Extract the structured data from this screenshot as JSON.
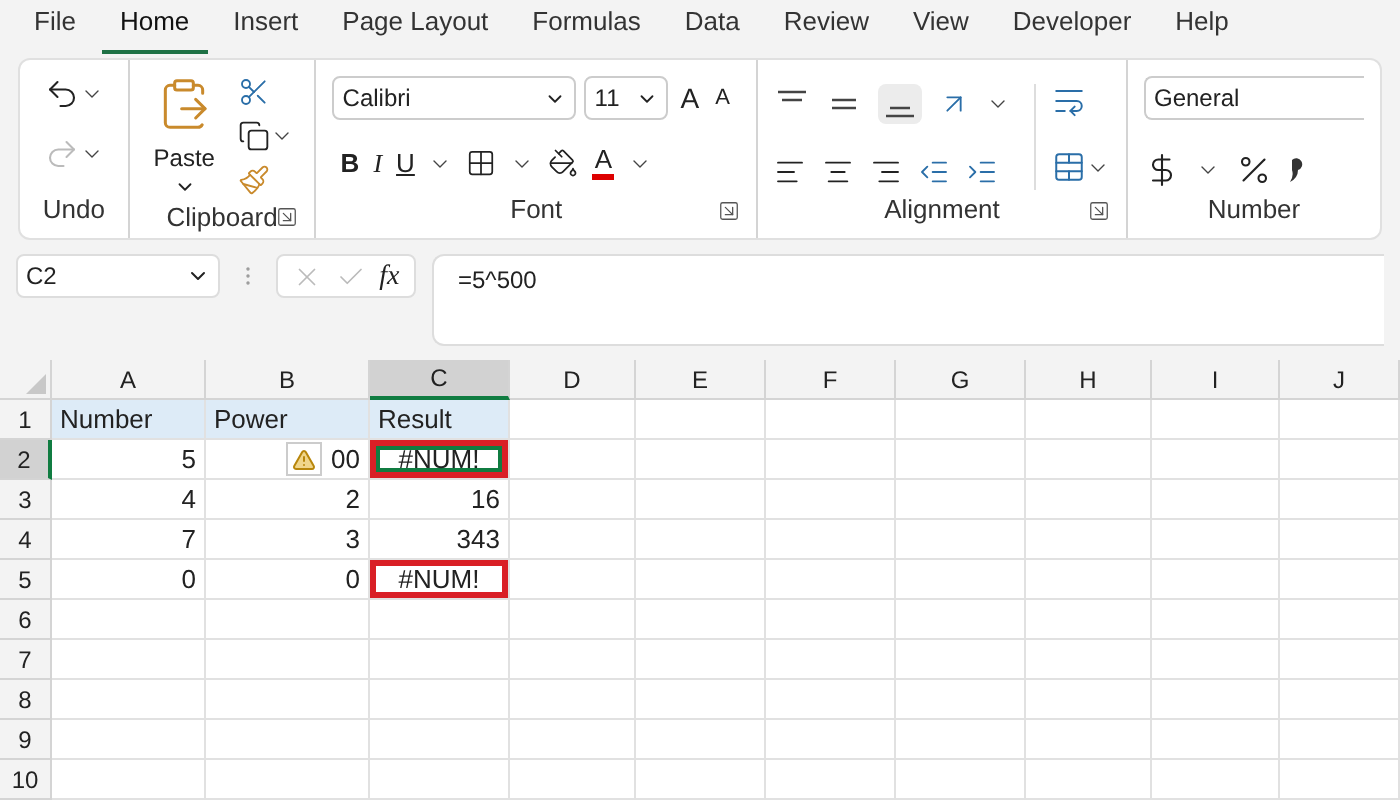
{
  "menu": [
    {
      "label": "File",
      "selected": false
    },
    {
      "label": "Home",
      "selected": true
    },
    {
      "label": "Insert",
      "selected": false
    },
    {
      "label": "Page Layout",
      "selected": false
    },
    {
      "label": "Formulas",
      "selected": false
    },
    {
      "label": "Data",
      "selected": false
    },
    {
      "label": "Review",
      "selected": false
    },
    {
      "label": "View",
      "selected": false
    },
    {
      "label": "Developer",
      "selected": false
    },
    {
      "label": "Help",
      "selected": false
    }
  ],
  "ribbon": {
    "undo": {
      "label": "Undo"
    },
    "clipboard": {
      "label": "Clipboard",
      "paste": "Paste"
    },
    "font": {
      "label": "Font",
      "name": "Calibri",
      "size": "11",
      "bold": "B",
      "italic": "I",
      "underline": "U",
      "grow": "A",
      "shrink": "A",
      "font_color_letter": "A"
    },
    "alignment": {
      "label": "Alignment"
    },
    "number": {
      "label": "Number",
      "format": "General"
    }
  },
  "formula_bar": {
    "name_box": "C2",
    "fx": "fx",
    "formula": "=5^500"
  },
  "sheet": {
    "columns": [
      {
        "label": "A",
        "selected": false
      },
      {
        "label": "B",
        "selected": false
      },
      {
        "label": "C",
        "selected": true
      },
      {
        "label": "D",
        "selected": false
      },
      {
        "label": "E",
        "selected": false
      },
      {
        "label": "F",
        "selected": false
      },
      {
        "label": "G",
        "selected": false
      },
      {
        "label": "H",
        "selected": false
      },
      {
        "label": "I",
        "selected": false
      },
      {
        "label": "J",
        "selected": false
      }
    ],
    "rows": [
      {
        "label": "1",
        "selected": false,
        "cells": [
          {
            "text": "Number",
            "kind": "header",
            "selected": false,
            "highlighted": false,
            "warning": false
          },
          {
            "text": "Power",
            "kind": "header",
            "selected": false,
            "highlighted": false,
            "warning": false
          },
          {
            "text": "Result",
            "kind": "header",
            "selected": false,
            "highlighted": false,
            "warning": false
          }
        ]
      },
      {
        "label": "2",
        "selected": true,
        "cells": [
          {
            "text": "5",
            "kind": "number",
            "selected": false,
            "highlighted": false,
            "warning": false
          },
          {
            "text": "00",
            "kind": "number",
            "selected": false,
            "highlighted": false,
            "warning": true
          },
          {
            "text": "#NUM!",
            "kind": "error",
            "selected": true,
            "highlighted": true,
            "warning": false
          }
        ]
      },
      {
        "label": "3",
        "selected": false,
        "cells": [
          {
            "text": "4",
            "kind": "number",
            "selected": false,
            "highlighted": false,
            "warning": false
          },
          {
            "text": "2",
            "kind": "number",
            "selected": false,
            "highlighted": false,
            "warning": false
          },
          {
            "text": "16",
            "kind": "number",
            "selected": false,
            "highlighted": false,
            "warning": false
          }
        ]
      },
      {
        "label": "4",
        "selected": false,
        "cells": [
          {
            "text": "7",
            "kind": "number",
            "selected": false,
            "highlighted": false,
            "warning": false
          },
          {
            "text": "3",
            "kind": "number",
            "selected": false,
            "highlighted": false,
            "warning": false
          },
          {
            "text": "343",
            "kind": "number",
            "selected": false,
            "highlighted": false,
            "warning": false
          }
        ]
      },
      {
        "label": "5",
        "selected": false,
        "cells": [
          {
            "text": "0",
            "kind": "number",
            "selected": false,
            "highlighted": false,
            "warning": false
          },
          {
            "text": "0",
            "kind": "number",
            "selected": false,
            "highlighted": false,
            "warning": false
          },
          {
            "text": "#NUM!",
            "kind": "error",
            "selected": false,
            "highlighted": true,
            "warning": false
          }
        ]
      },
      {
        "label": "6",
        "selected": false
      },
      {
        "label": "7",
        "selected": false
      },
      {
        "label": "8",
        "selected": false
      },
      {
        "label": "9",
        "selected": false
      },
      {
        "label": "10",
        "selected": false
      }
    ]
  }
}
